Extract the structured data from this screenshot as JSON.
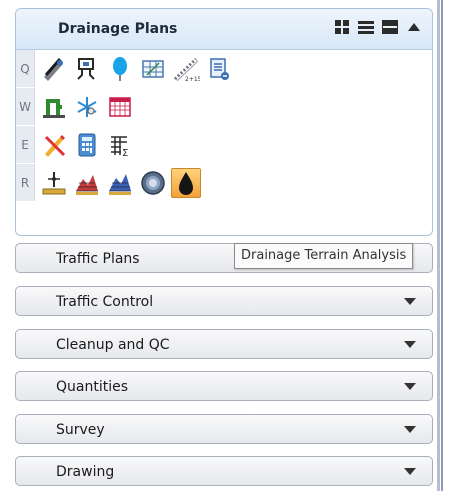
{
  "panel": {
    "expanded_group": {
      "title": "Drainage Plans",
      "header_icons": [
        "grid-view-icon",
        "list-view-icon",
        "full-view-icon",
        "collapse-up-icon"
      ],
      "rows": [
        {
          "letter": "Q",
          "tools": [
            "pipe-tool-icon",
            "structure-tool-icon",
            "balloon-icon",
            "grid-table-icon",
            "profile-measure-icon",
            "report-icon"
          ]
        },
        {
          "letter": "W",
          "tools": [
            "pipe-network-icon",
            "snowflake-icon",
            "calendar-grid-icon"
          ]
        },
        {
          "letter": "E",
          "tools": [
            "pencil-eraser-icon",
            "calculator-icon",
            "sum-table-icon"
          ]
        },
        {
          "letter": "R",
          "tools": [
            "survey-point-icon",
            "terrain-profile-icon",
            "terrain-profile-2-icon",
            "globe-circle-icon",
            "drainage-terrain-icon"
          ]
        }
      ],
      "active_tool": "drainage-terrain-icon"
    },
    "collapsed_groups": [
      {
        "label": "Traffic Plans"
      },
      {
        "label": "Traffic Control"
      },
      {
        "label": "Cleanup and QC"
      },
      {
        "label": "Quantities"
      },
      {
        "label": "Survey"
      },
      {
        "label": "Drawing"
      }
    ]
  },
  "tooltip": {
    "text": "Drainage Terrain Analysis"
  },
  "colors": {
    "header_bg": "#dbe8f7",
    "active_tool_bg": "#f6b24a",
    "border": "#a9c3de"
  }
}
